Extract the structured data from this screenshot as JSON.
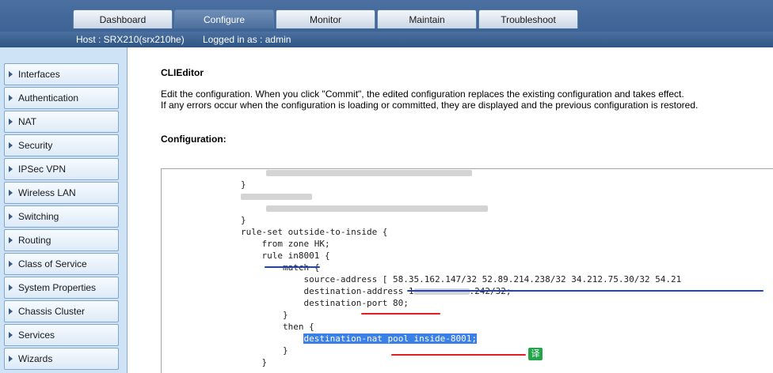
{
  "nav": {
    "tabs": [
      {
        "label": "Dashboard",
        "active": false
      },
      {
        "label": "Configure",
        "active": true
      },
      {
        "label": "Monitor",
        "active": false
      },
      {
        "label": "Maintain",
        "active": false
      },
      {
        "label": "Troubleshoot",
        "active": false
      }
    ]
  },
  "header": {
    "host": "Host : SRX210(srx210he)",
    "login": "Logged in as : admin"
  },
  "sidebar": {
    "items": [
      {
        "label": "Interfaces"
      },
      {
        "label": "Authentication"
      },
      {
        "label": "NAT"
      },
      {
        "label": "Security"
      },
      {
        "label": "IPSec VPN"
      },
      {
        "label": "Wireless LAN"
      },
      {
        "label": "Switching"
      },
      {
        "label": "Routing"
      },
      {
        "label": "Class of Service"
      },
      {
        "label": "System Properties"
      },
      {
        "label": "Chassis Cluster"
      },
      {
        "label": "Services"
      },
      {
        "label": "Wizards"
      }
    ]
  },
  "main": {
    "title": "CLIEditor",
    "description_line1": "Edit the configuration. When you click \"Commit\", the edited configuration replaces the existing configuration and takes effect.",
    "description_line2": "If any errors occur when the configuration is loading or committed, they are displayed and the previous configuration is restored.",
    "config_label": "Configuration:"
  },
  "editor": {
    "lines": {
      "close1": "}",
      "close2": "}",
      "ruleset": "rule-set outside-to-inside {",
      "from": "    from zone HK;",
      "rule": "    rule in8001 {",
      "match": "        match {",
      "src": "            source-address [ 58.35.162.147/32 52.89.214.238/32 34.212.75.30/32 54.21",
      "dst_a": "            destination-address 1",
      "dst_b": ".242/32;",
      "port": "            destination-port 80;",
      "match_close": "        }",
      "then": "        then {",
      "nat_indent": "            ",
      "nat": "destination-nat pool inside-8001;",
      "then_close": "        }",
      "rule_close": "    }"
    },
    "translate_badge": "译"
  },
  "colors": {
    "nav_bg": "#3e6395",
    "sidebar_bg": "#cfe3f6",
    "selection": "#3b80e6",
    "underline_blue": "#2040c8",
    "underline_red": "#e02020",
    "badge_green": "#23a54a"
  }
}
